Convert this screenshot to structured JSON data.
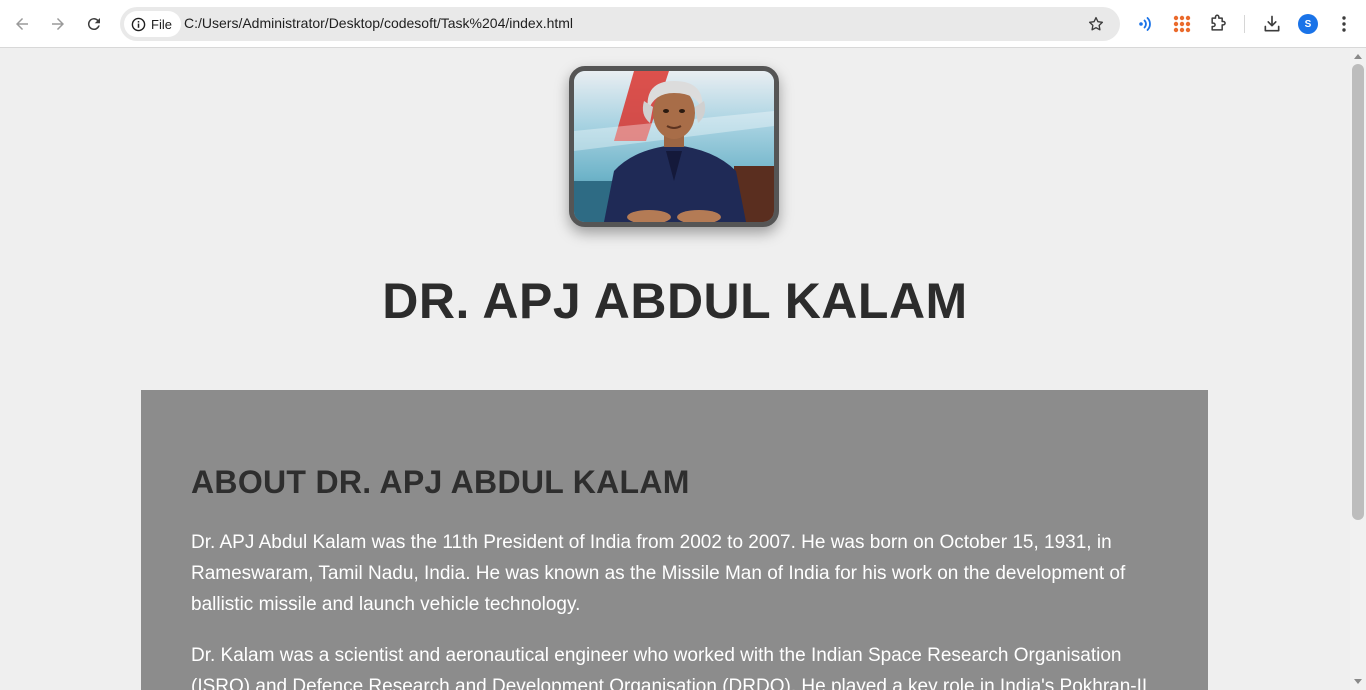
{
  "browser": {
    "site_chip_label": "File",
    "url": "C:/Users/Administrator/Desktop/codesoft/Task%204/index.html",
    "profile_initial": "S",
    "accent_color": "#1a73e8"
  },
  "icons": [
    "back-icon",
    "forward-icon",
    "reload-icon",
    "info-icon",
    "star-icon",
    "audio-extension-icon",
    "apps-extension-icon",
    "extensions-puzzle-icon",
    "download-icon",
    "menu-kebab-icon"
  ],
  "page": {
    "title": "DR. APJ ABDUL KALAM",
    "about": {
      "heading": "ABOUT DR. APJ ABDUL KALAM",
      "paragraphs": [
        "Dr. APJ Abdul Kalam was the 11th President of India from 2002 to 2007. He was born on October 15, 1931, in Rameswaram, Tamil Nadu, India. He was known as the Missile Man of India for his work on the development of ballistic missile and launch vehicle technology.",
        "Dr. Kalam was a scientist and aeronautical engineer who worked with the Indian Space Research Organisation (ISRO) and Defence Research and Development Organisation (DRDO). He played a key role in India's Pokhran-II"
      ]
    },
    "colors": {
      "background": "#efefef",
      "section_background": "#8c8c8c",
      "title_text": "#2c2c2c",
      "body_text": "#ffffff"
    }
  }
}
